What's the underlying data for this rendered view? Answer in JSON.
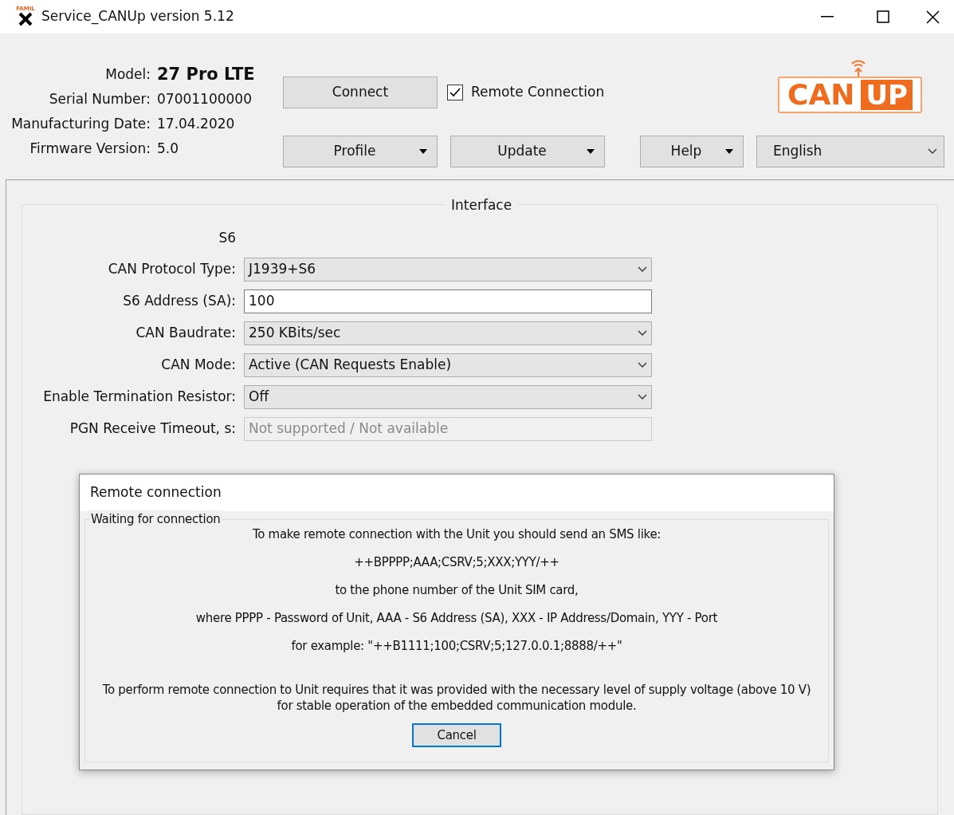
{
  "window": {
    "title": "Service_CANUp version 5.12",
    "icon_text": "FAMIL"
  },
  "device_info": [
    {
      "label": "Model:",
      "value": "27 Pro LTE",
      "kind": "strong"
    },
    {
      "label": "Serial Number:",
      "value": "07001100000",
      "kind": "plain"
    },
    {
      "label": "Manufacturing Date:",
      "value": "17.04.2020",
      "kind": "plain"
    },
    {
      "label": "Firmware Version:",
      "value": "5.0",
      "kind": "plain"
    }
  ],
  "connect_button": "Connect",
  "remote_connection": {
    "label": "Remote Connection",
    "checked": true
  },
  "logo": {
    "left": "CAN",
    "right": "UP"
  },
  "menu_buttons": [
    {
      "label": "Profile"
    },
    {
      "label": "Update"
    },
    {
      "label": "Help"
    }
  ],
  "language": {
    "value": "English"
  },
  "interface": {
    "title": "Interface",
    "section": "S6",
    "fields": [
      {
        "label": "CAN Protocol Type:",
        "value": "J1939+S6",
        "kind": "dropdown"
      },
      {
        "label": "S6 Address (SA):",
        "value": "100",
        "kind": "input"
      },
      {
        "label": "CAN Baudrate:",
        "value": "250 KBits/sec",
        "kind": "dropdown"
      },
      {
        "label": "CAN Mode:",
        "value": "Active (CAN Requests Enable)",
        "kind": "dropdown"
      },
      {
        "label": "Enable Termination Resistor:",
        "value": "Off",
        "kind": "dropdown"
      },
      {
        "label": "PGN Receive Timeout, s:",
        "value": "Not supported / Not available",
        "kind": "disabled"
      }
    ]
  },
  "dialog": {
    "title": "Remote connection",
    "group": "Waiting for connection",
    "lines": [
      "To make remote connection with the Unit you should send an SMS like:",
      "++BPPPP;AAA;CSRV;5;XXX;YYY/++",
      "to the phone number of the Unit SIM card,",
      "where PPPP - Password of Unit, AAA - S6 Address (SA), XXX - IP Address/Domain, YYY - Port",
      "for example: \"++B1111;100;CSRV;5;127.0.0.1;8888/++\""
    ],
    "note": [
      "To perform remote connection to Unit requires that it was provided with the necessary level of supply voltage (above 10 V)",
      "for stable operation of the embedded communication module."
    ],
    "button": "Cancel"
  }
}
